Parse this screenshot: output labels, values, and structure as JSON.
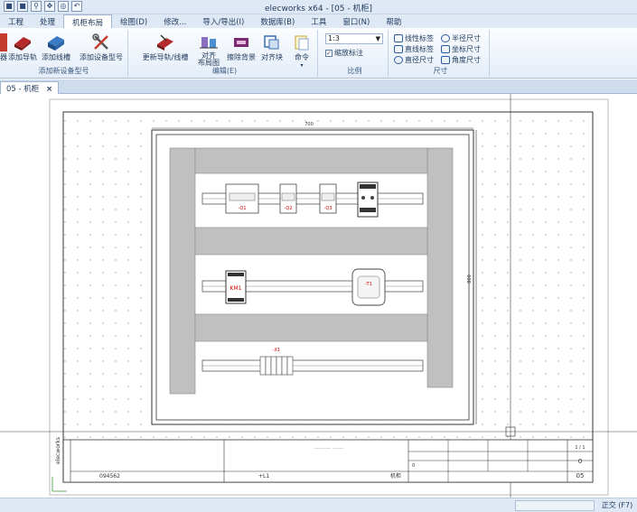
{
  "window": {
    "title": "elecworks x64 - [05 - 机柜]"
  },
  "quick_access": [
    "save-icon",
    "save-all-icon",
    "zoom-icon",
    "pan-icon",
    "binoculars-icon",
    "undo-icon"
  ],
  "ribbon_tabs": [
    "工程",
    "处理",
    "机柜布局",
    "绘图(D)",
    "修改...",
    "导入/导出(I)",
    "数据库(B)",
    "工具",
    "窗口(N)",
    "帮助"
  ],
  "active_tab": "机柜布局",
  "ribbon": {
    "add_group": {
      "label": "添加新设备型号",
      "buttons": [
        "添加导轨",
        "添加线槽",
        "添加设备型号"
      ],
      "cut_label": "器"
    },
    "edit_group": {
      "label": "编辑(E)",
      "buttons": [
        "更新导轨/线槽",
        "对齐",
        "布局图",
        "擦除背景",
        "对齐块",
        "命令"
      ],
      "align_sub": "对齐 布局图"
    },
    "scale_group": {
      "label": "比例",
      "scale_value": "1:3",
      "scale_annotation": "缩放标注",
      "scale_annotation_checked": true
    },
    "dimension_group": {
      "label": "尺寸",
      "buttons": [
        "线性标签",
        "半径尺寸",
        "直线标签",
        "坐标尺寸",
        "直径尺寸",
        "角度尺寸"
      ]
    }
  },
  "document_tab": {
    "label": "05 - 机柜",
    "close": "×"
  },
  "drawing": {
    "dim_width": "700",
    "dim_height": "800",
    "devices": [
      {
        "label": "-Q1"
      },
      {
        "label": "-Q2"
      },
      {
        "label": "-Q3"
      },
      {
        "label": "KM1"
      },
      {
        "label": "-T1"
      },
      {
        "label": "-X1"
      }
    ],
    "title_block": {
      "drawing_no": "094562",
      "location": "+L1",
      "type": "机柜",
      "sheet_ratio": "1 / 1",
      "sheet_index": "0",
      "page_no": "05",
      "logo": "elecworks",
      "blurred_name": "——— ——",
      "revision_cell": "0"
    }
  },
  "status": {
    "ortho": "正交 (F7)"
  }
}
